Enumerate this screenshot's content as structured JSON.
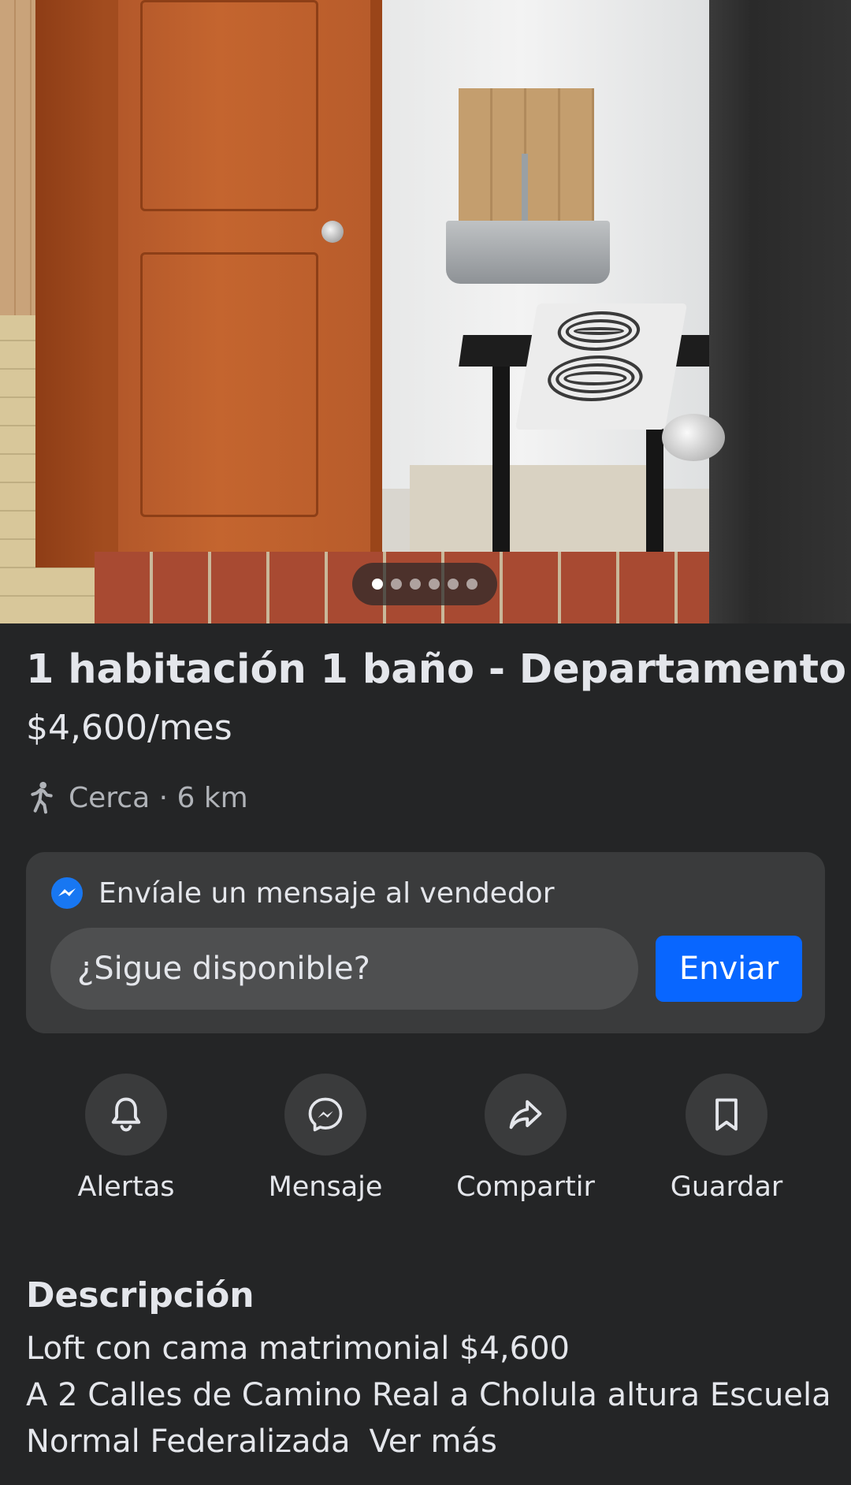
{
  "gallery": {
    "image_count": 6,
    "active_index": 0
  },
  "listing": {
    "title": "1 habitación 1 baño - Departamento",
    "price": "$4,600/mes",
    "location": "Cerca · 6 km"
  },
  "message": {
    "heading": "Envíale un mensaje al vendedor",
    "input_value": "¿Sigue disponible?",
    "send_label": "Enviar"
  },
  "actions": [
    {
      "label": "Alertas",
      "icon": "bell-icon"
    },
    {
      "label": "Mensaje",
      "icon": "messenger-icon"
    },
    {
      "label": "Compartir",
      "icon": "share-icon"
    },
    {
      "label": "Guardar",
      "icon": "bookmark-icon"
    }
  ],
  "description": {
    "heading": "Descripción",
    "line1": "Loft con cama matrimonial $4,600",
    "line2": "A 2 Calles de Camino Real a Cholula altura Escuela",
    "line3": "Normal Federalizada",
    "see_more": "Ver más"
  },
  "colors": {
    "background": "#242526",
    "card": "#3a3b3c",
    "accent": "#0866ff",
    "text": "#e4e6eb",
    "secondary_text": "#b0b3b8"
  }
}
